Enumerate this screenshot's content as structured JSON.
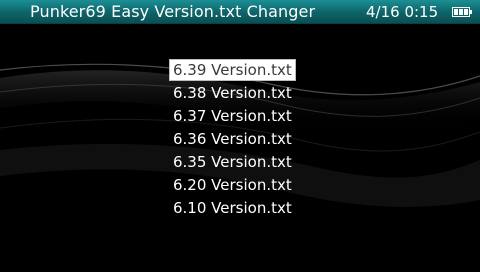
{
  "titlebar": {
    "title": "Punker69 Easy Version.txt Changer",
    "clock": "4/16 0:15",
    "battery_icon": "battery-full-icon",
    "battery_level": 1.0
  },
  "menu": {
    "selected_index": 0,
    "items": [
      {
        "label": "6.39 Version.txt"
      },
      {
        "label": "6.38 Version.txt"
      },
      {
        "label": "6.37 Version.txt"
      },
      {
        "label": "6.36 Version.txt"
      },
      {
        "label": "6.35 Version.txt"
      },
      {
        "label": "6.20 Version.txt"
      },
      {
        "label": "6.10 Version.txt"
      }
    ]
  },
  "colors": {
    "titlebar": "#0d6368",
    "background": "#000000",
    "text": "#ffffff",
    "selected_text": "#3a3a3a",
    "selected_background": "#ffffff"
  }
}
